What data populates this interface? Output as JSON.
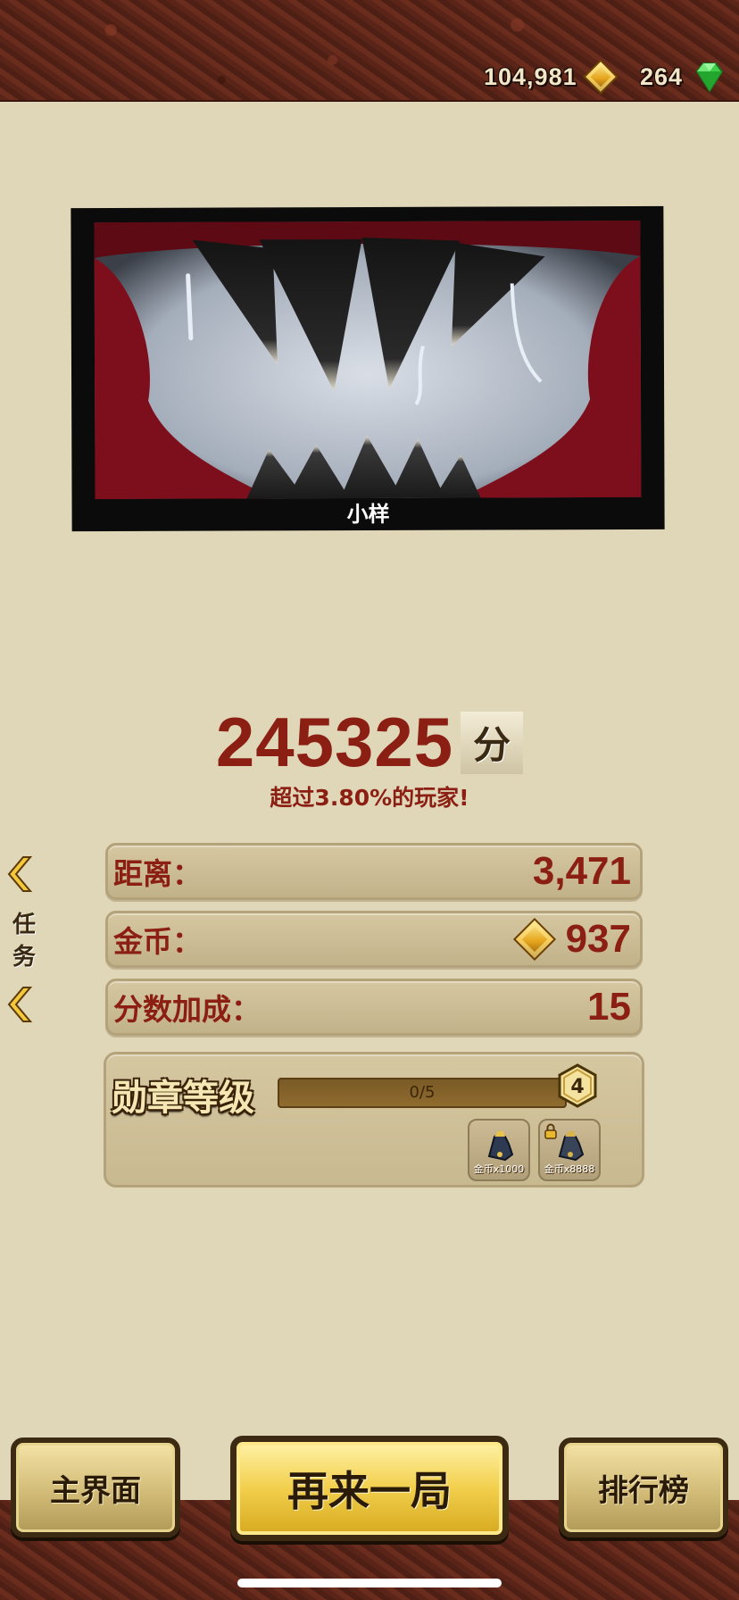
{
  "header": {
    "coins": "104,981",
    "gems": "264",
    "coin_icon": "gold-diamond-coin-icon",
    "gem_icon": "green-gem-icon"
  },
  "banner": {
    "caption": "小样",
    "art": "monster-jaws-illustration"
  },
  "score": {
    "value": "245325",
    "unit": "分",
    "percentile_text": "超过3.80%的玩家!"
  },
  "side_tasks": {
    "label_top": "任",
    "label_bottom": "务",
    "icon": "chevron-left-icon"
  },
  "stats": {
    "distance_label": "距离：",
    "distance_value": "3,471",
    "coins_label": "金币：",
    "coins_value": "937",
    "bonus_label": "分数加成：",
    "bonus_value": "15"
  },
  "medal": {
    "title": "勋章等级",
    "progress_text": "0/5",
    "progress_fraction": 0,
    "level": "4",
    "rewards": [
      {
        "label": "金币x1000",
        "locked": false
      },
      {
        "label": "金币x8888",
        "locked": true
      }
    ]
  },
  "buttons": {
    "home": "主界面",
    "replay": "再来一局",
    "leaderboard": "排行榜"
  },
  "colors": {
    "accent_red": "#8c1f14",
    "background": "#e0d6b8",
    "gold": "#f2cf4c"
  }
}
